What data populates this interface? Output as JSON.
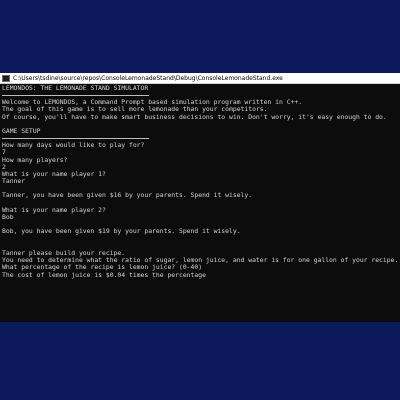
{
  "window": {
    "title": "C:\\Users\\tsdine\\source\\repos\\ConsoleLemonadeStand\\Debug\\ConsoleLemonadeStand.exe"
  },
  "console": {
    "header": "LEMONDOS: THE LEMONADE STAND SIMULATOR",
    "intro": [
      "Welcome to LEMONDOS, a Command Prompt based simulation program written in C++.",
      "The goal of this game is to sell more lemonade than your competitors.",
      "Of course, you'll have to make smart business decisions to win. Don't worry, it's easy enough to do."
    ],
    "setup_header": "GAME SETUP",
    "setup": [
      "How many days would like to play for?",
      "7",
      "How many players?",
      "2",
      "What is your name player 1?",
      "Tanner",
      "",
      "Tanner, you have been given $16 by your parents. Spend it wisely.",
      "",
      "What is your name player 2?",
      "Bob",
      "",
      "Bob, you have been given $19 by your parents. Spend it wisely.",
      "",
      "",
      "Tanner please build your recipe.",
      "You need to determine what the ratio of sugar, lemon juice, and water is for one gallon of your recipe.",
      "What percentage of the recipe is lemon juice? (0-40)",
      "The cost of lemon juice is $0.04 times the percentage"
    ]
  }
}
